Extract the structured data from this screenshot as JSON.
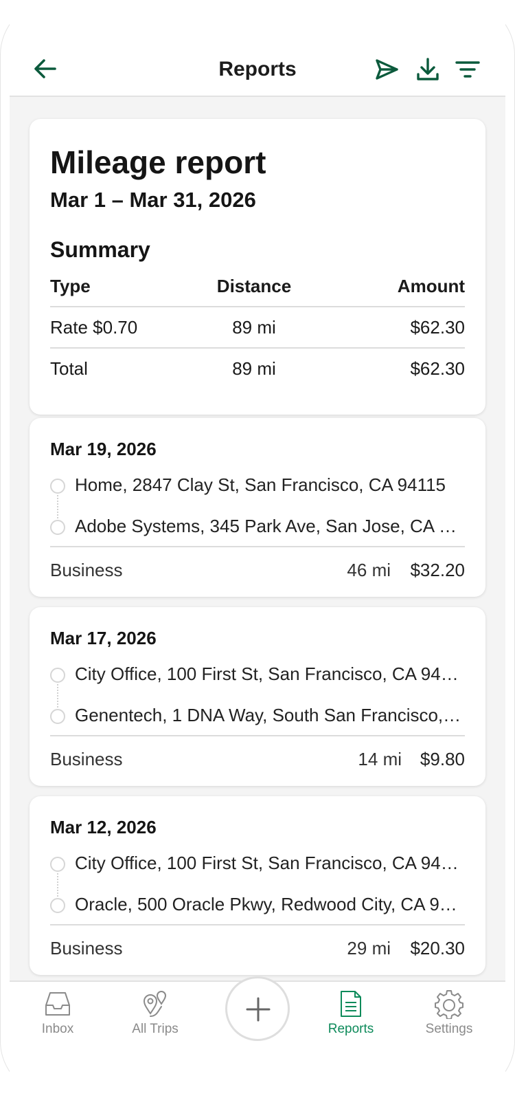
{
  "header": {
    "title": "Reports"
  },
  "report": {
    "title": "Mileage report",
    "range": "Mar 1 – Mar 31, 2026"
  },
  "summary": {
    "heading": "Summary",
    "columns": [
      "Type",
      "Distance",
      "Amount"
    ],
    "rows": [
      {
        "type": "Rate $0.70",
        "distance": "89 mi",
        "amount": "$62.30"
      },
      {
        "type": "Total",
        "distance": "89 mi",
        "amount": "$62.30"
      }
    ]
  },
  "trips": [
    {
      "date": "Mar 19, 2026",
      "from": "Home, 2847 Clay St, San Francisco, CA 94115",
      "to": "Adobe Systems, 345 Park Ave, San Jose, CA 9…",
      "category": "Business",
      "distance": "46 mi",
      "amount": "$32.20"
    },
    {
      "date": "Mar 17, 2026",
      "from": "City Office, 100 First St, San Francisco, CA 941…",
      "to": "Genentech, 1 DNA Way, South San Francisco,…",
      "category": "Business",
      "distance": "14 mi",
      "amount": "$9.80"
    },
    {
      "date": "Mar 12, 2026",
      "from": "City Office, 100 First St, San Francisco, CA 941…",
      "to": "Oracle, 500 Oracle Pkwy, Redwood City, CA 9…",
      "category": "Business",
      "distance": "29 mi",
      "amount": "$20.30"
    }
  ],
  "nav": {
    "items": [
      {
        "label": "Inbox",
        "icon": "inbox-icon"
      },
      {
        "label": "All Trips",
        "icon": "map-pins-icon"
      },
      {
        "label": "Reports",
        "icon": "document-icon",
        "active": true
      },
      {
        "label": "Settings",
        "icon": "gear-icon"
      }
    ],
    "add_icon": "plus-icon"
  },
  "colors": {
    "brand": "#0b5a3c",
    "active_nav": "#0d8a5a",
    "background": "#f4f4f4"
  }
}
